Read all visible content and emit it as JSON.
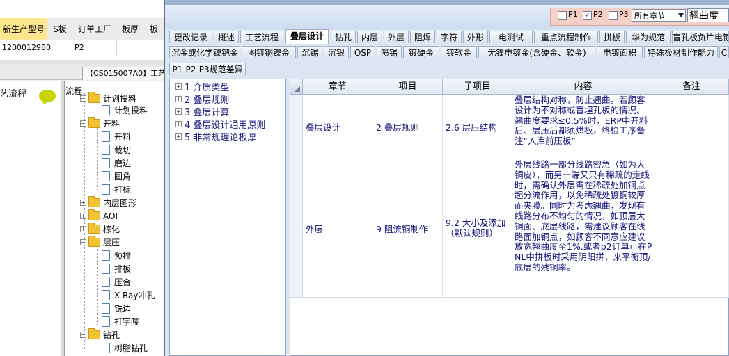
{
  "bg_grid": {
    "headers": [
      "新生产型号",
      "S板",
      "订单工厂",
      "板厚",
      "板"
    ],
    "row": [
      "1200012980",
      "",
      "P2",
      "",
      ""
    ]
  },
  "bg_doc_tab": "【CS015007A0】工艺",
  "bg_left_title": "工艺流程",
  "tree_title": "流程",
  "tree": [
    {
      "label": "计划投料",
      "kind": "folder-partial"
    },
    {
      "label": "计划投料",
      "kind": "page"
    },
    {
      "label": "开料",
      "kind": "folder"
    },
    {
      "label": "开料",
      "kind": "page"
    },
    {
      "label": "裁切",
      "kind": "page"
    },
    {
      "label": "磨边",
      "kind": "page"
    },
    {
      "label": "圆角",
      "kind": "page"
    },
    {
      "label": "打标",
      "kind": "page"
    },
    {
      "label": "内层图形",
      "kind": "folder"
    },
    {
      "label": "AOI",
      "kind": "folder"
    },
    {
      "label": "棕化",
      "kind": "folder"
    },
    {
      "label": "层压",
      "kind": "folder"
    },
    {
      "label": "预排",
      "kind": "page"
    },
    {
      "label": "排板",
      "kind": "page"
    },
    {
      "label": "压合",
      "kind": "page"
    },
    {
      "label": "X-Ray冲孔",
      "kind": "page"
    },
    {
      "label": "铣边",
      "kind": "page"
    },
    {
      "label": "打字唛",
      "kind": "page"
    },
    {
      "label": "钻孔",
      "kind": "folder"
    },
    {
      "label": "树脂钻孔",
      "kind": "page"
    }
  ],
  "options": {
    "p1": "P1",
    "p2": "P2",
    "p3": "P3",
    "p1_checked": false,
    "p2_checked": true,
    "p3_checked": false,
    "chapter_select": "所有章节",
    "search_value": "翘曲度"
  },
  "tabs_row1": [
    "更改记录",
    "概述",
    "工艺流程",
    "叠层设计",
    "钻孔",
    "内层",
    "外层",
    "阻焊",
    "字符",
    "外形",
    "电测试",
    "重点流程制作",
    "拼板",
    "华为规范",
    "盲孔板负片电镀"
  ],
  "tabs_row2": [
    "沉金或化学镍钯金",
    "图镀铜镍金",
    "沉锡",
    "沉银",
    "OSP",
    "喷锡",
    "镀硬金",
    "镀软金",
    "无镍电镀金(含硬金、软金)",
    "电镀面积",
    "特殊板材制作能力",
    "C"
  ],
  "tabs_row3": [
    "P1-P2-P3规范差异"
  ],
  "active_tab": "叠层设计",
  "chapter_tree": [
    "1 介质类型",
    "2 叠层规则",
    "3 叠层计算",
    "4 叠层设计通用原则",
    "5 非常规理论板厚"
  ],
  "grid": {
    "headers": [
      "章节",
      "项目",
      "子项目",
      "内容",
      "备注"
    ],
    "rows": [
      {
        "chapter": "叠层设计",
        "item": "2 叠层规则",
        "subitem": "2.6 层压结构",
        "content": "叠层结构对称，防止翘曲。若顾客设计为不对称或盲埋孔板的情况、翘曲度要求≤0.5%时，ERP中开料后、层压后都须烘板，终检工序备注“入库前压板”",
        "remark": ""
      },
      {
        "chapter": "外层",
        "item": "9 阻流铜制作",
        "subitem": "9.2 大小及添加（默认规则）",
        "content": "外层线路一部分线路密急（如为大铜皮），而另一端又只有稀疏的走线时，需确认外层需在稀疏处加铜点起分流作用，以免稀疏处镀铜较厚而夹膜。同时为考虑翘曲，发现有线路分布不均匀的情况，如顶层大铜面、底层线路，需建议顾客在线路面加铜点，如顾客不同意应建议放宽翘曲度至1%.或者p2订单可在PNL中拼板时采用阴阳拼，来平衡顶/底层的残铜率。",
        "remark": ""
      }
    ]
  },
  "colors": {
    "window_bg": "#dce6f3",
    "options_bg": "#f6cfc7",
    "highlight_header": "#fde68e",
    "text_blue": "#12127a"
  }
}
